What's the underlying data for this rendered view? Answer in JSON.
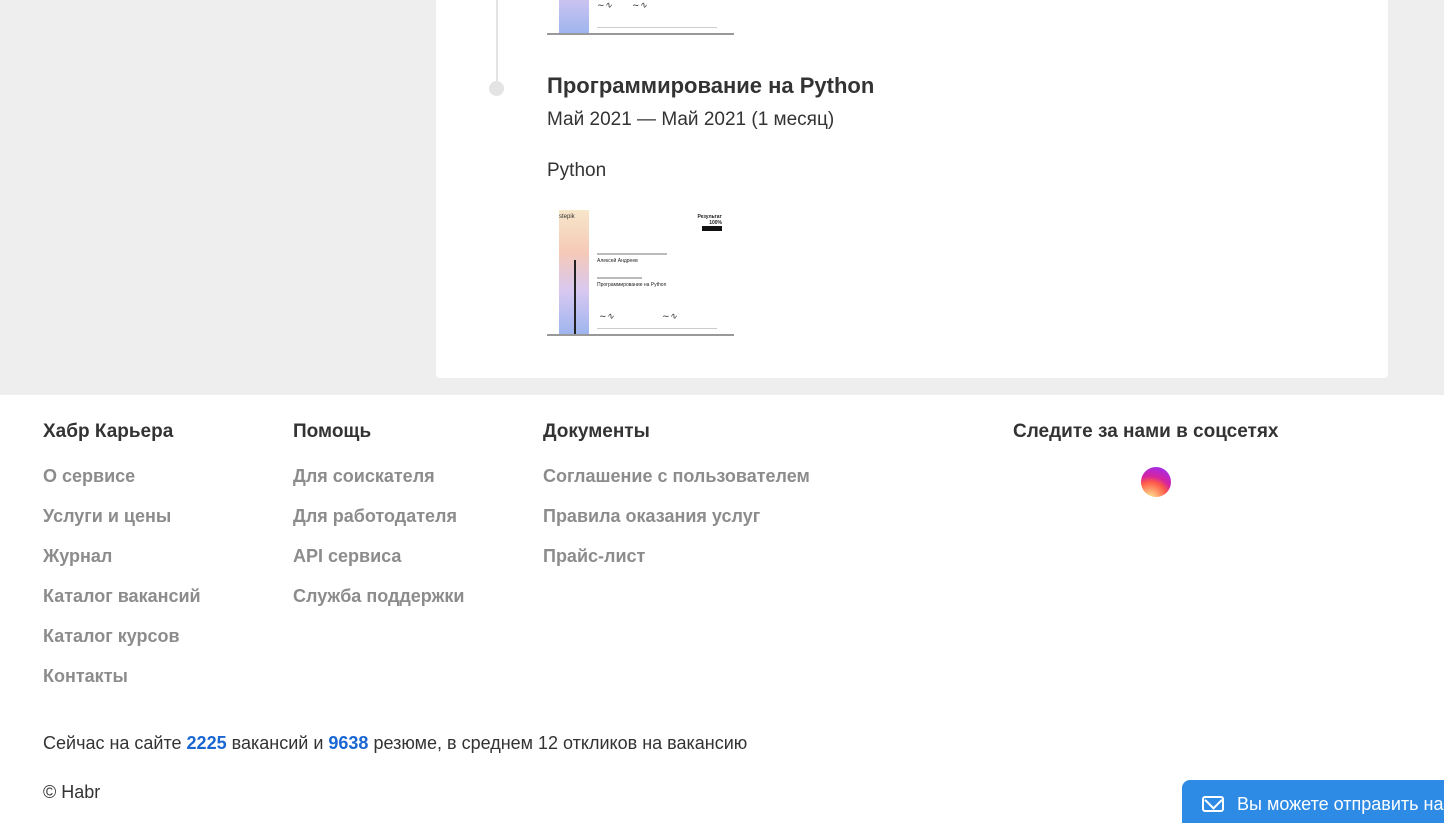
{
  "course": {
    "title": "Программирование на Python",
    "dates": "Май 2021 — Май 2021 (1 месяц)",
    "skill": "Python",
    "certificate": {
      "platform": "stepik",
      "score_label": "Результат",
      "score_value": "100%",
      "student": "Алексей Андреев",
      "course_name": "Программирование на Python"
    }
  },
  "footer": {
    "col1": {
      "title": "Хабр Карьера",
      "links": [
        "О сервисе",
        "Услуги и цены",
        "Журнал",
        "Каталог вакансий",
        "Каталог курсов",
        "Контакты"
      ]
    },
    "col2": {
      "title": "Помощь",
      "links": [
        "Для соискателя",
        "Для работодателя",
        "API сервиса",
        "Служба поддержки"
      ]
    },
    "col3": {
      "title": "Документы",
      "links": [
        "Соглашение с пользователем",
        "Правила оказания услуг",
        "Прайс-лист"
      ]
    },
    "col4": {
      "title": "Следите за нами в соцсетях",
      "icon": "instagram-icon"
    },
    "stats": {
      "prefix": "Сейчас на сайте",
      "vacancies": "2225",
      "middle1": "вакансий и",
      "resumes": "9638",
      "suffix": "резюме, в среднем 12 откликов на вакансию"
    },
    "copyright": "© Habr"
  },
  "feedback": {
    "text": "Вы можете отправить на"
  },
  "colors": {
    "accent": "#1a66d2",
    "feedback_bg": "#2e8be5",
    "page_bg": "#eeeeee"
  }
}
